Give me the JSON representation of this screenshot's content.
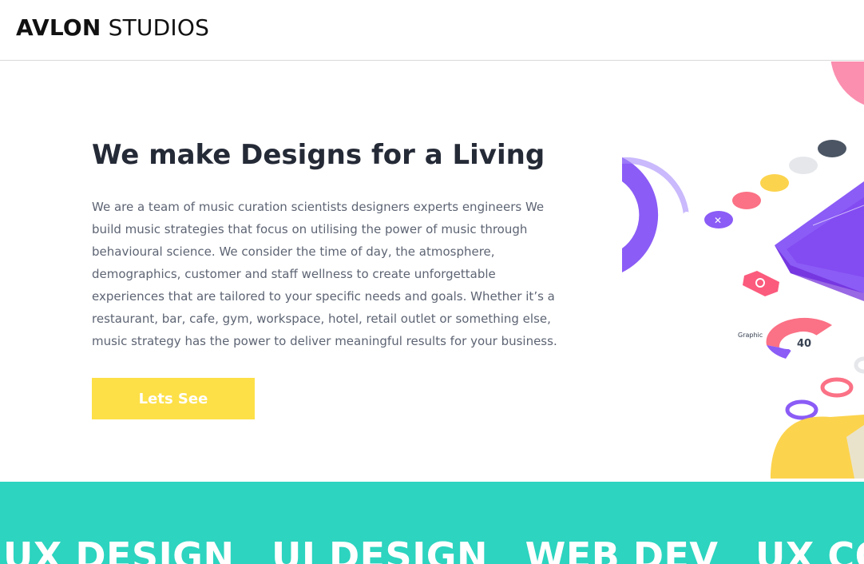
{
  "brand": {
    "name_strong": "AVLON",
    "name_light": "STUDIOS"
  },
  "hero": {
    "headline": "We make Designs for a Living",
    "description": "We are a team of music curation scientists designers experts engineers We build music strategies that focus on utilising the power of music through behavioural science. We consider the time of day, the atmosphere, demographics, customer and staff wellness to create unforgettable experiences that are tailored to your specific needs and goals. Whether it’s a restaurant, bar, cafe, gym, workspace, hotel, retail outlet or something else, music strategy has the power to deliver meaningful results for your business.",
    "cta_label": "Lets See"
  },
  "illustration": {
    "gauge_value": "40",
    "gauge_label": "Graphic"
  },
  "services": [
    "UX DESIGN",
    "UI DESIGN",
    "WEB DEV",
    "UX CONSU"
  ],
  "colors": {
    "accent_yellow": "#fde047",
    "band_teal": "#2dd4bf",
    "purple": "#8b5cf6",
    "pink": "#fb7185"
  }
}
